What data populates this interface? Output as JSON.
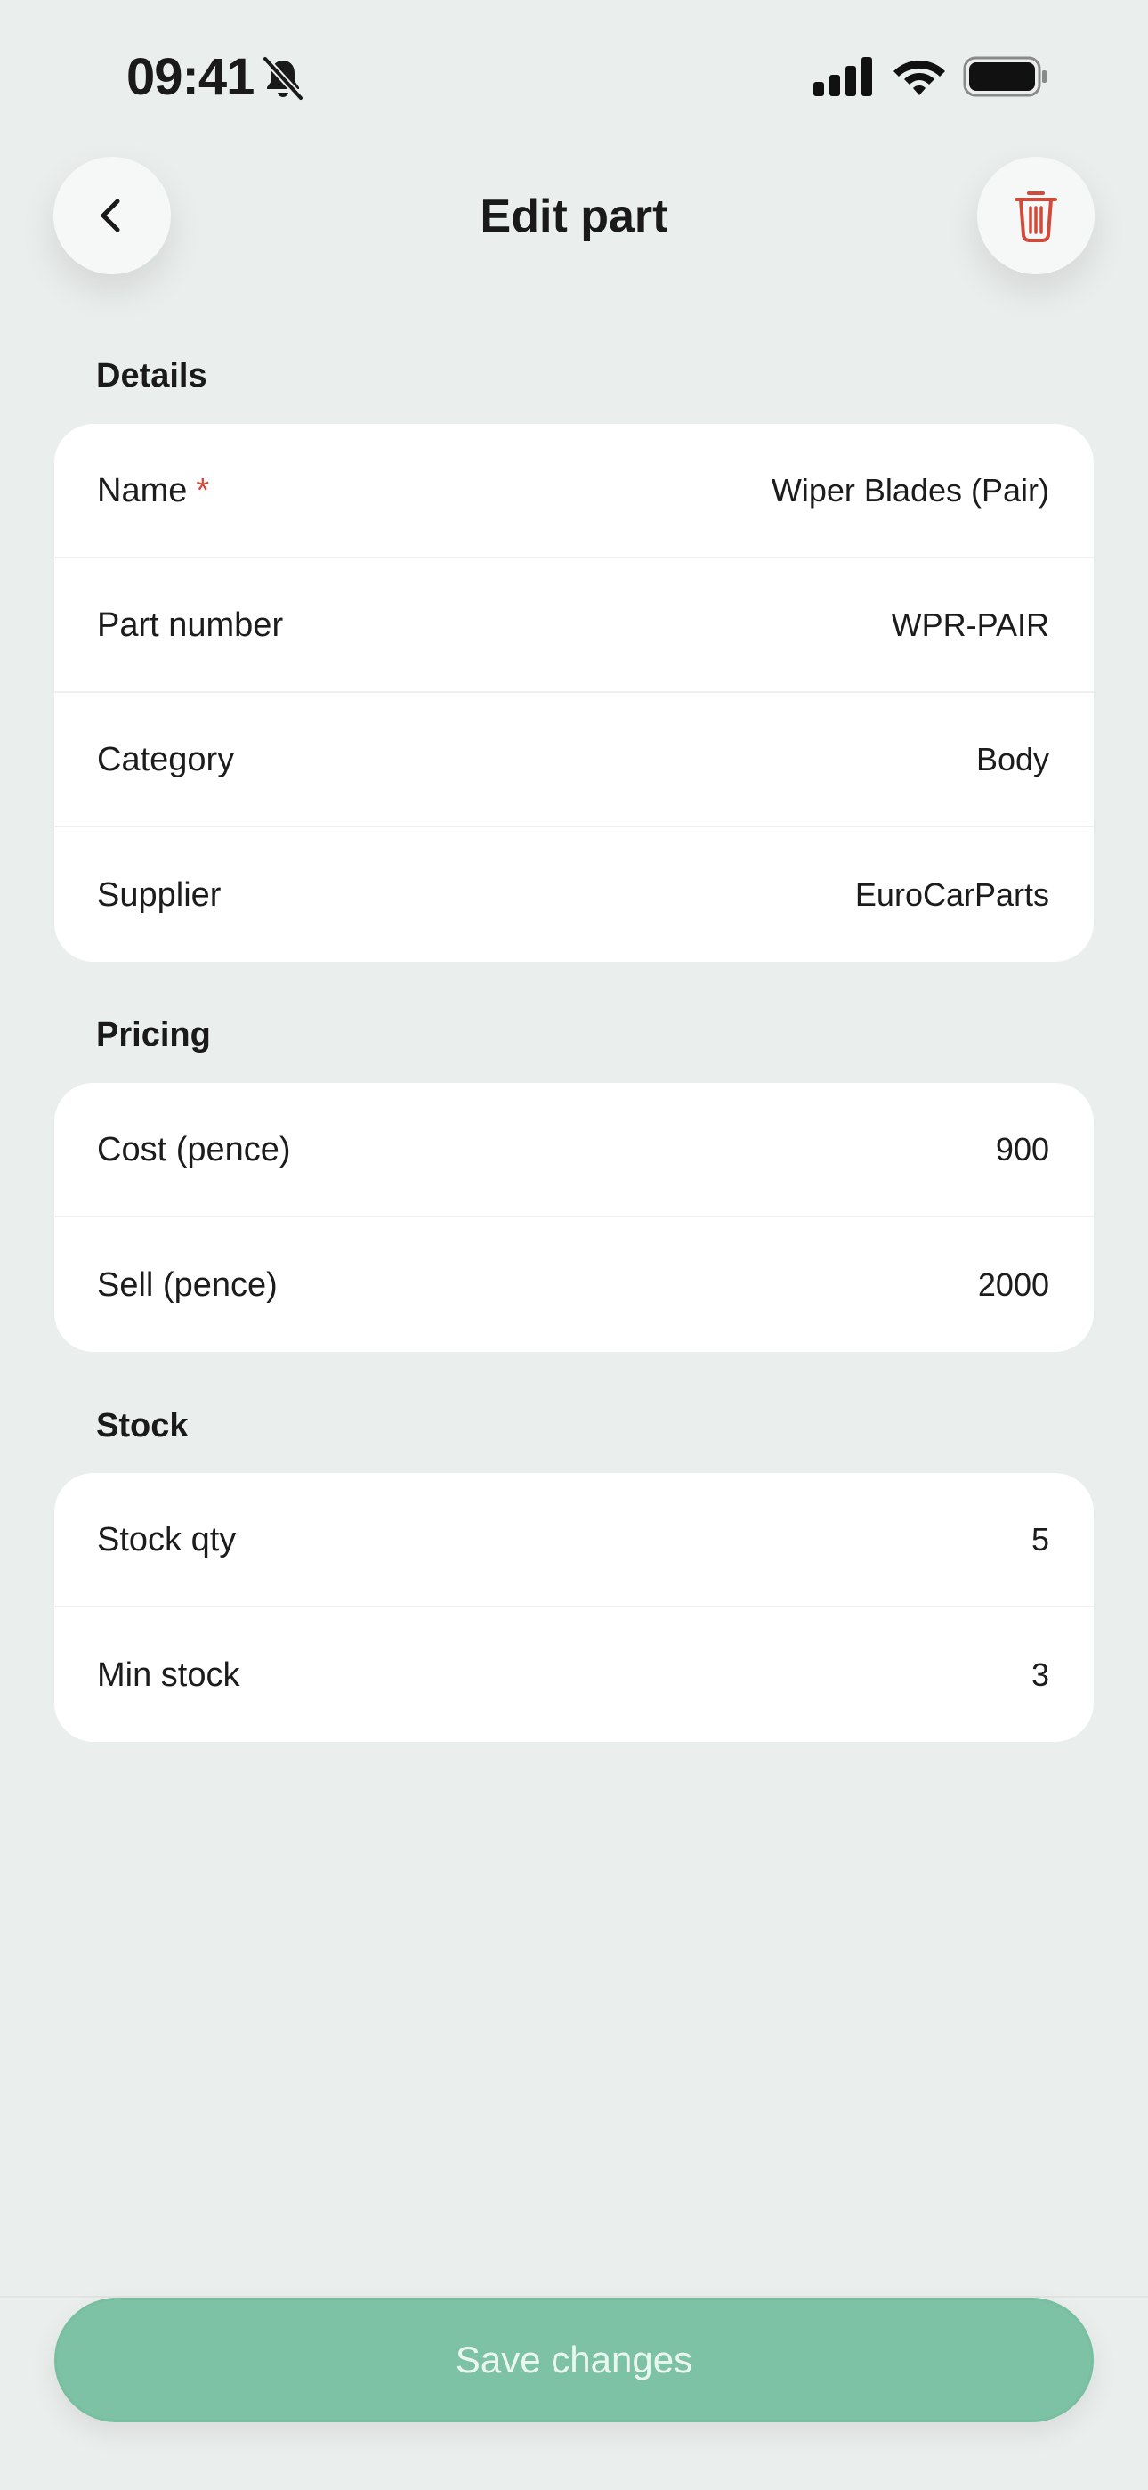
{
  "status_bar": {
    "time": "09:41",
    "icons": [
      "bell-slash-icon",
      "cellular-signal-icon",
      "wifi-icon",
      "battery-icon"
    ]
  },
  "header": {
    "title": "Edit part",
    "back_icon": "chevron-left-icon",
    "delete_icon": "trash-icon"
  },
  "colors": {
    "background": "#EAEEEC",
    "card": "#FFFFFF",
    "accent": "#7EC2A6",
    "danger": "#D14A3A"
  },
  "sections": {
    "details": {
      "title": "Details",
      "rows": [
        {
          "label": "Name",
          "required_mark": "*",
          "value": "Wiper Blades (Pair)"
        },
        {
          "label": "Part number",
          "value": "WPR-PAIR"
        },
        {
          "label": "Category",
          "value": "Body"
        },
        {
          "label": "Supplier",
          "value": "EuroCarParts"
        }
      ]
    },
    "pricing": {
      "title": "Pricing",
      "rows": [
        {
          "label": "Cost (pence)",
          "value": "900"
        },
        {
          "label": "Sell (pence)",
          "value": "2000"
        }
      ]
    },
    "stock": {
      "title": "Stock",
      "rows": [
        {
          "label": "Stock qty",
          "value": "5"
        },
        {
          "label": "Min stock",
          "value": "3"
        }
      ]
    }
  },
  "footer": {
    "save_label": "Save changes"
  }
}
